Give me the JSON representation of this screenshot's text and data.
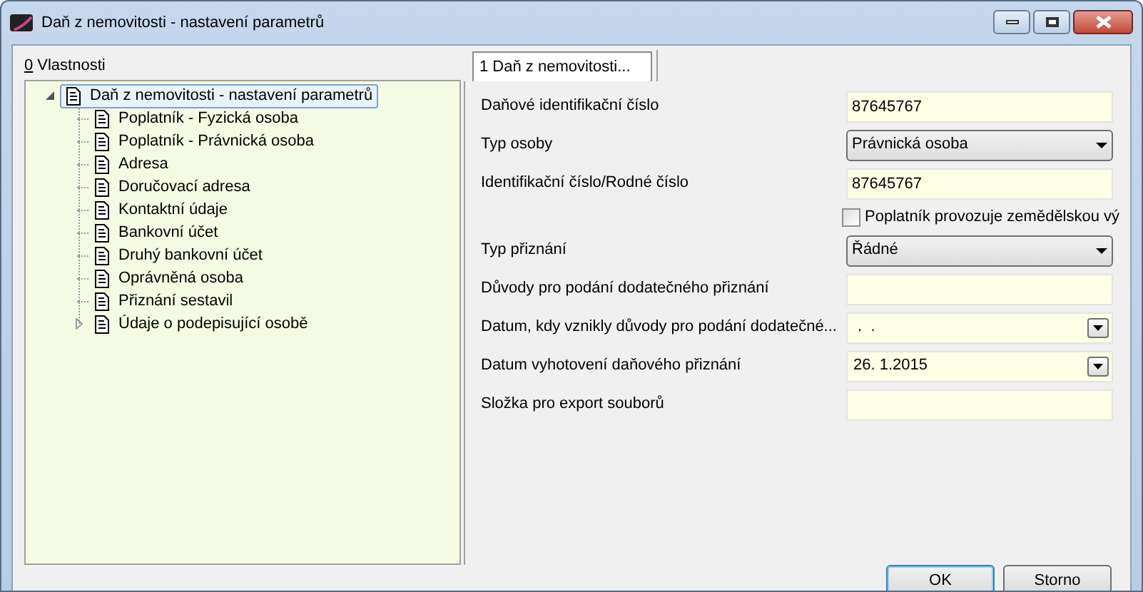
{
  "window": {
    "title": "Daň z nemovitosti - nastavení parametrů"
  },
  "properties_panel": {
    "mnemonic": "0",
    "label": "Vlastnosti"
  },
  "tree": [
    {
      "label": "Daň z nemovitosti - nastavení parametrů",
      "selected": true,
      "expanded": true,
      "children": [
        {
          "label": "Poplatník - Fyzická osoba",
          "selected": false
        },
        {
          "label": "Poplatník - Právnická osoba",
          "selected": false
        },
        {
          "label": "Adresa",
          "selected": false
        },
        {
          "label": "Doručovací adresa",
          "selected": false
        },
        {
          "label": "Kontaktní údaje",
          "selected": false
        },
        {
          "label": "Bankovní účet",
          "selected": false
        },
        {
          "label": "Druhý bankovní účet",
          "selected": false
        },
        {
          "label": "Oprávněná osoba",
          "selected": false
        },
        {
          "label": "Přiznání sestavil",
          "selected": false
        },
        {
          "label": "Údaje o podepisující osobě",
          "selected": false,
          "expanded": false
        }
      ]
    }
  ],
  "tabs": [
    {
      "label": "1 Daň z nemovitosti...",
      "selected": true
    }
  ],
  "fields": [
    {
      "kind": "text",
      "label": "Daňové identifikační číslo",
      "value": "87645767"
    },
    {
      "kind": "select",
      "label": "Typ osoby",
      "value": "Právnická osoba"
    },
    {
      "kind": "text",
      "label": "Identifikační číslo/Rodné číslo",
      "value": "87645767"
    },
    {
      "kind": "checkbox",
      "label": "Poplatník provozuje zemědělskou vý",
      "checked": false
    },
    {
      "kind": "select",
      "label": "Typ přiznání",
      "value": "Řádné"
    },
    {
      "kind": "text",
      "label": "Důvody pro podání dodatečného přiznání"
    },
    {
      "kind": "date",
      "label": "Datum, kdy vznikly důvody pro podání dodatečné...",
      "value": " .  ."
    },
    {
      "kind": "date",
      "label": "Datum vyhotovení daňového přiznání",
      "value": "26. 1.2015"
    },
    {
      "kind": "text",
      "label": "Složka pro export souborů"
    }
  ],
  "buttons": [
    {
      "label": "OK",
      "default": true
    },
    {
      "label": "Storno",
      "default": false
    }
  ]
}
